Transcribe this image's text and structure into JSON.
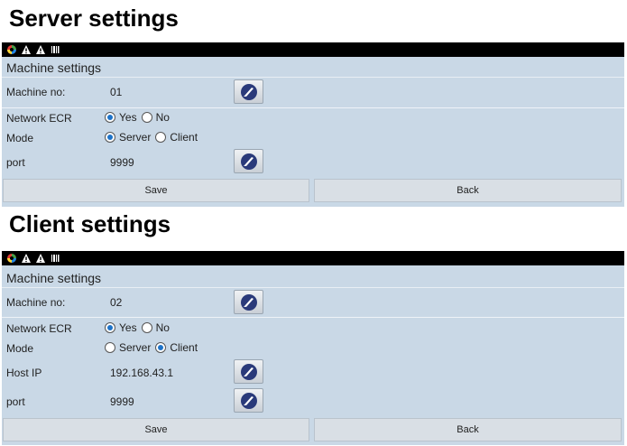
{
  "server_section": {
    "heading": "Server settings",
    "title": "Machine settings",
    "machine_no_label": "Machine no:",
    "machine_no_value": "01",
    "network_ecr_label": "Network ECR",
    "network_ecr_options": [
      "Yes",
      "No"
    ],
    "network_ecr_selected": "Yes",
    "mode_label": "Mode",
    "mode_options": [
      "Server",
      "Client"
    ],
    "mode_selected": "Server",
    "port_label": "port",
    "port_value": "9999",
    "save_label": "Save",
    "back_label": "Back"
  },
  "client_section": {
    "heading": "Client settings",
    "title": "Machine settings",
    "machine_no_label": "Machine no:",
    "machine_no_value": "02",
    "network_ecr_label": "Network ECR",
    "network_ecr_options": [
      "Yes",
      "No"
    ],
    "network_ecr_selected": "Yes",
    "mode_label": "Mode",
    "mode_options": [
      "Server",
      "Client"
    ],
    "mode_selected": "Client",
    "host_ip_label": "Host IP",
    "host_ip_value": "192.168.43.1",
    "port_label": "port",
    "port_value": "9999",
    "save_label": "Save",
    "back_label": "Back"
  },
  "status_icons": [
    "app-icon",
    "warning-icon",
    "warning-icon",
    "barcode-icon"
  ],
  "colors": {
    "panel_background": "#c9d8e6",
    "status_bar": "#000000",
    "radio_selected": "#1e73c8",
    "button_background": "#d9dfe5"
  }
}
